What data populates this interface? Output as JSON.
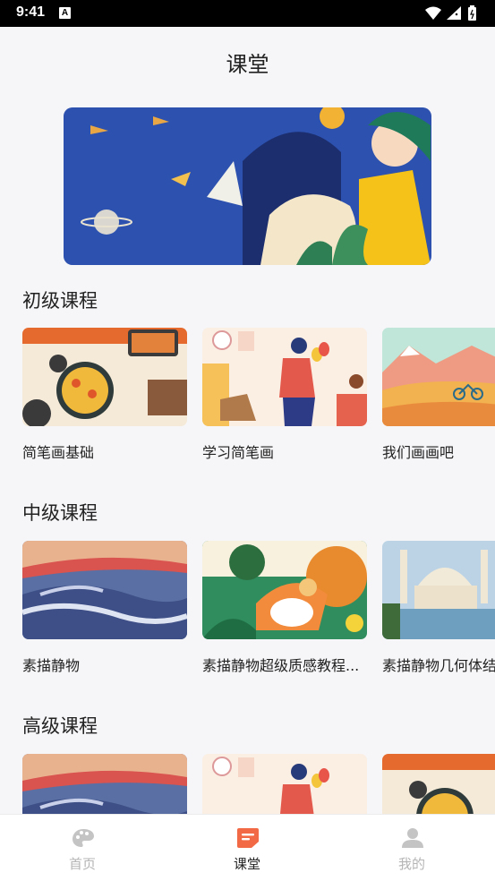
{
  "status_bar": {
    "time": "9:41",
    "notification_glyph": "A"
  },
  "header": {
    "title": "课堂"
  },
  "banner": {
    "alt": ""
  },
  "sections": [
    {
      "title": "初级课程",
      "cards": [
        {
          "label": "简笔画基础"
        },
        {
          "label": "学习简笔画"
        },
        {
          "label": "我们画画吧"
        }
      ]
    },
    {
      "title": "中级课程",
      "cards": [
        {
          "label": "素描静物"
        },
        {
          "label": "素描静物超级质感教程..."
        },
        {
          "label": "素描静物几何体结"
        }
      ]
    },
    {
      "title": "高级课程",
      "cards": [
        {
          "label": ""
        },
        {
          "label": ""
        },
        {
          "label": ""
        }
      ]
    }
  ],
  "tabbar": {
    "tabs": [
      {
        "label": "首页",
        "icon": "palette-icon",
        "active": false
      },
      {
        "label": "课堂",
        "icon": "classroom-icon",
        "active": true
      },
      {
        "label": "我的",
        "icon": "person-icon",
        "active": false
      }
    ]
  },
  "colors": {
    "accent": "#f26a45",
    "inactive": "#b5b5b5",
    "text": "#222222",
    "background": "#f6f6f8"
  }
}
